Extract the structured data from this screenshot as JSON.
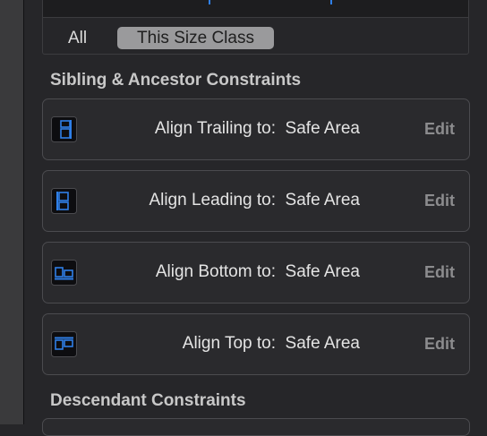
{
  "segments": {
    "all": "All",
    "this_size_class": "This Size Class"
  },
  "sections": {
    "sibling_title": "Sibling & Ancestor Constraints",
    "descendant_title": "Descendant Constraints"
  },
  "constraints": [
    {
      "label": "Align Trailing to:  Safe Area",
      "edit": "Edit",
      "icon": "align-trailing-icon"
    },
    {
      "label": "Align Leading to:  Safe Area",
      "edit": "Edit",
      "icon": "align-leading-icon"
    },
    {
      "label": "Align Bottom to:  Safe Area",
      "edit": "Edit",
      "icon": "align-bottom-icon"
    },
    {
      "label": "Align Top to:  Safe Area",
      "edit": "Edit",
      "icon": "align-top-icon"
    }
  ],
  "colors": {
    "accent": "#2f7fe8",
    "panel": "#262629",
    "row_border": "#4b4b4f"
  }
}
